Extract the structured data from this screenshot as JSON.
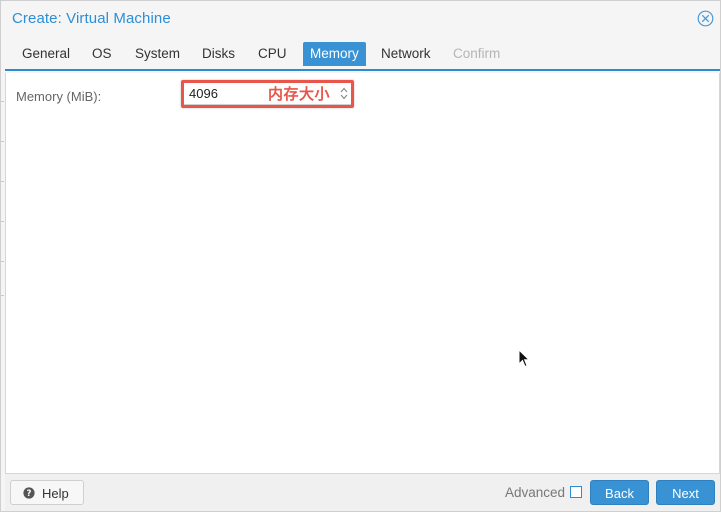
{
  "window": {
    "title": "Create: Virtual Machine",
    "close_icon": "close-circle-icon"
  },
  "tabs": [
    {
      "label": "General",
      "state": "normal"
    },
    {
      "label": "OS",
      "state": "normal"
    },
    {
      "label": "System",
      "state": "normal"
    },
    {
      "label": "Disks",
      "state": "normal"
    },
    {
      "label": "CPU",
      "state": "normal"
    },
    {
      "label": "Memory",
      "state": "active"
    },
    {
      "label": "Network",
      "state": "normal"
    },
    {
      "label": "Confirm",
      "state": "disabled"
    }
  ],
  "memory": {
    "label": "Memory (MiB):",
    "value": "4096",
    "annotation": "内存大小"
  },
  "footer": {
    "help_label": "Help",
    "advanced_label": "Advanced",
    "advanced_checked": false,
    "back_label": "Back",
    "next_label": "Next"
  },
  "colors": {
    "accent": "#3892d4",
    "title": "#2c8fd6",
    "annotation": "#e8554a"
  }
}
